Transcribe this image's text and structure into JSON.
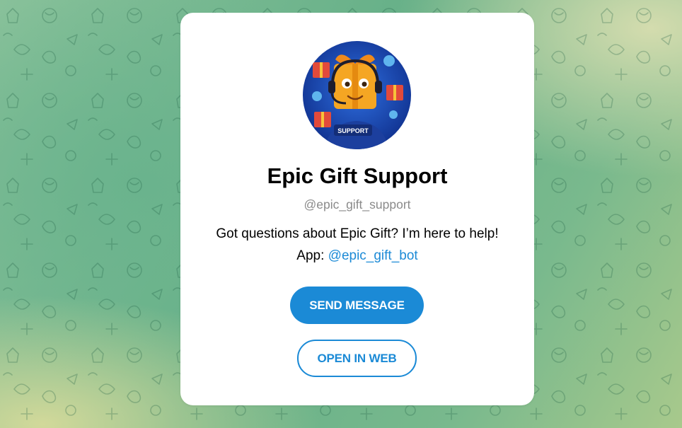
{
  "profile": {
    "name": "Epic Gift Support",
    "username": "@epic_gift_support",
    "description_line1": "Got questions about Epic Gift? I’m here to help!",
    "app_prefix": "App: ",
    "app_link": "@epic_gift_bot",
    "avatar_badge": "SUPPORT"
  },
  "actions": {
    "send_message": "SEND MESSAGE",
    "open_in_web": "OPEN IN WEB"
  },
  "colors": {
    "accent": "#1b8ad6",
    "muted_text": "#8a8a8a",
    "card_bg": "#ffffff"
  },
  "icons": {
    "background": "doodle-pattern",
    "avatar": "gift-box-mascot"
  }
}
